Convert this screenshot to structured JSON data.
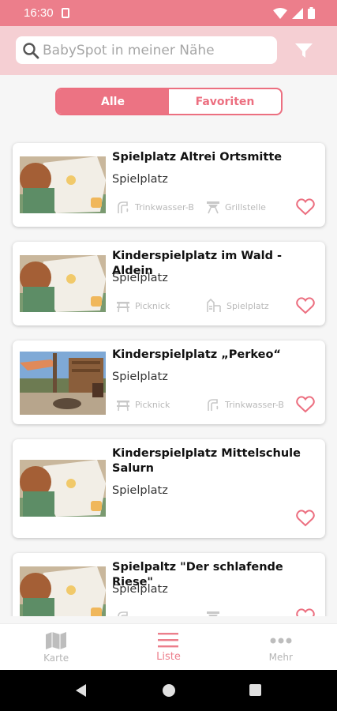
{
  "status": {
    "time": "16:30"
  },
  "search": {
    "placeholder": "BabySpot in meiner Nähe"
  },
  "tabs": {
    "all_label": "Alle",
    "favorites_label": "Favoriten"
  },
  "places": [
    {
      "title": "Spielplatz Altrei Ortsmitte",
      "type": "Spielplatz",
      "features": [
        {
          "icon": "water-tap-icon",
          "label": "Trinkwasser-B"
        },
        {
          "icon": "grill-icon",
          "label": "Grillstelle"
        }
      ],
      "image": "child-drawing"
    },
    {
      "title": "Kinderspielplatz im Wald - Aldein",
      "type": "Spielplatz",
      "features": [
        {
          "icon": "picnic-table-icon",
          "label": "Picknick"
        },
        {
          "icon": "playground-icon",
          "label": "Spielplatz"
        }
      ],
      "image": "child-drawing"
    },
    {
      "title": "Kinderspielplatz „Perkeo“",
      "type": "Spielplatz",
      "features": [
        {
          "icon": "picnic-table-icon",
          "label": "Picknick"
        },
        {
          "icon": "water-tap-icon",
          "label": "Trinkwasser-B"
        }
      ],
      "image": "playground-photo"
    },
    {
      "title": "Kinderspielplatz Mittelschule Salurn",
      "type": "Spielplatz",
      "features": [],
      "image": "child-drawing"
    },
    {
      "title": "Spielpaltz \"Der schlafende Riese\"",
      "type": "Spielplatz",
      "features": [
        {
          "icon": "water-tap-icon",
          "label": ""
        },
        {
          "icon": "grill-icon",
          "label": ""
        }
      ],
      "image": "child-drawing"
    }
  ],
  "nav": {
    "map_label": "Karte",
    "list_label": "Liste",
    "more_label": "Mehr"
  },
  "colors": {
    "primary": "#ec7383",
    "header": "#f5cfd3",
    "status_bar": "#ec7e8b"
  }
}
